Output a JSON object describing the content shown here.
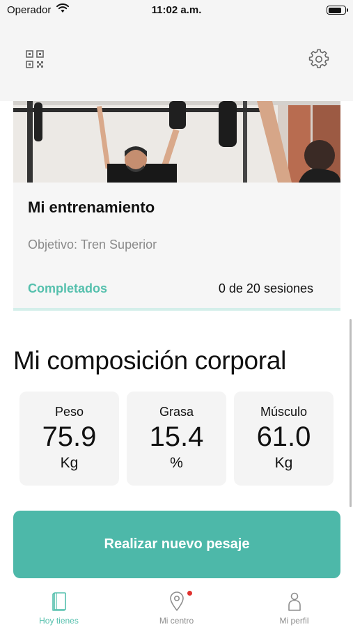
{
  "status_bar": {
    "carrier": "Operador",
    "time": "11:02 a.m.",
    "battery_level": 0.85
  },
  "header": {
    "left_icon": "qr-code-icon",
    "right_icon": "gear-icon"
  },
  "workout_card": {
    "title": "Mi entrenamiento",
    "goal": "Objetivo: Tren Superior",
    "completed_label": "Completados",
    "sessions_text": "0 de 20 sesiones",
    "progress_fraction": 0.0
  },
  "body_composition": {
    "title": "Mi composición corporal",
    "metrics": [
      {
        "label": "Peso",
        "value": "75.9",
        "unit": "Kg"
      },
      {
        "label": "Grasa",
        "value": "15.4",
        "unit": "%"
      },
      {
        "label": "Músculo",
        "value": "61.0",
        "unit": "Kg"
      }
    ]
  },
  "cta": {
    "label": "Realizar nuevo pesaje",
    "color": "#4db8a9"
  },
  "tab_bar": {
    "items": [
      {
        "label": "Hoy tienes",
        "icon": "book-icon",
        "active": true
      },
      {
        "label": "Mi centro",
        "icon": "location-pin-icon",
        "active": false,
        "badge": true
      },
      {
        "label": "Mi perfil",
        "icon": "person-icon",
        "active": false
      }
    ]
  },
  "colors": {
    "accent": "#55c0ad",
    "muted_text": "#8a8a8a",
    "badge": "#e0322f"
  }
}
